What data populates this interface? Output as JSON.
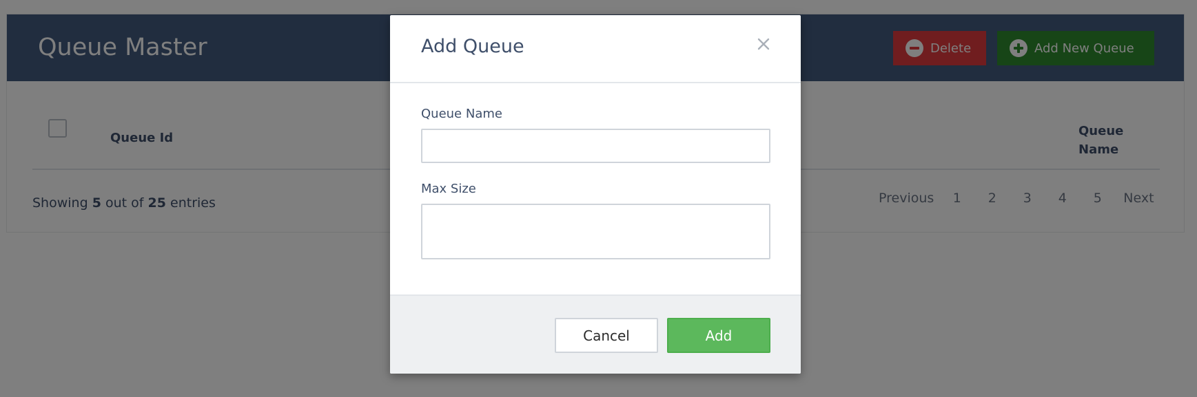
{
  "header": {
    "title": "Queue Master",
    "delete_label": "Delete",
    "add_label": "Add New Queue"
  },
  "table": {
    "columns": [
      "Queue Id",
      "Queue Name"
    ]
  },
  "footer": {
    "showing_prefix": "Showing",
    "shown_count": "5",
    "middle_text": "out of",
    "total_count": "25",
    "suffix": "entries"
  },
  "pagination": {
    "previous": "Previous",
    "pages": [
      "1",
      "2",
      "3",
      "4",
      "5"
    ],
    "next": "Next"
  },
  "modal": {
    "title": "Add Queue",
    "close_glyph": "×",
    "fields": {
      "queue_name_label": "Queue Name",
      "queue_name_value": "",
      "max_size_label": "Max Size",
      "max_size_value": ""
    },
    "cancel_label": "Cancel",
    "add_label": "Add"
  },
  "colors": {
    "header_bg": "#435b7f",
    "delete": "#e03a3f",
    "add_new": "#2f8a2f",
    "add_button": "#5cb85c",
    "overlay": "rgba(0,0,0,0.5)"
  },
  "icons": {
    "delete": "minus-circle-icon",
    "add_new": "plus-circle-icon",
    "close": "close-icon"
  }
}
